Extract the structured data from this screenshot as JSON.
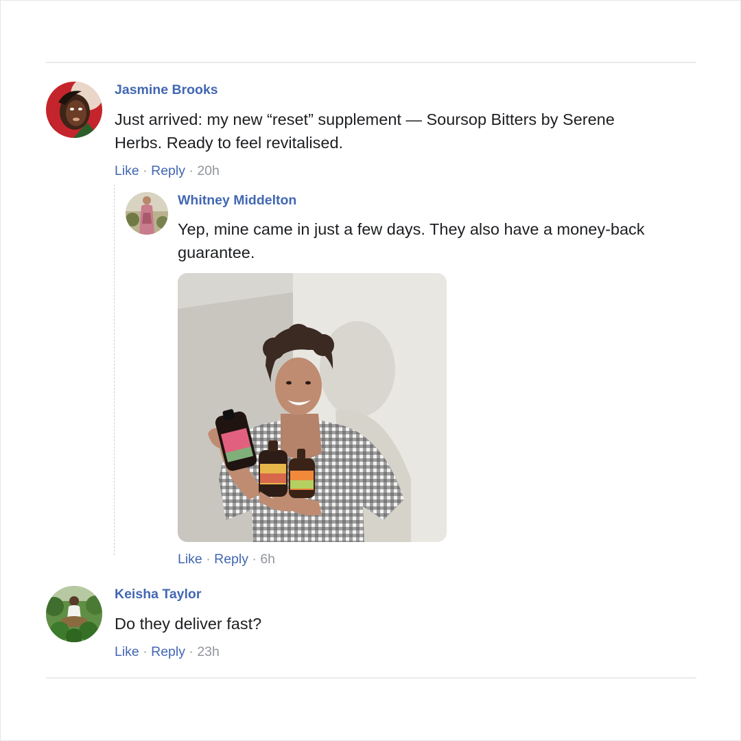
{
  "comments": [
    {
      "author": "Jasmine Brooks",
      "text_line1": "Just arrived: my new “reset” supplement — Soursop Bitters by Serene",
      "text_line2": "Herbs. Ready to feel revitalised.",
      "like_label": "Like",
      "reply_label": "Reply",
      "separator": "·",
      "time": "20h"
    },
    {
      "author": "Whitney Middelton",
      "text_line1": "Yep, mine came in just a few days. They also have a money-back",
      "text_line2": "guarantee.",
      "like_label": "Like",
      "reply_label": "Reply",
      "separator": "·",
      "time": "6h"
    },
    {
      "author": "Keisha Taylor",
      "text_line1": "Do they deliver fast?",
      "like_label": "Like",
      "reply_label": "Reply",
      "separator": "·",
      "time": "23h"
    }
  ],
  "colors": {
    "link": "#4267b2",
    "text": "#1c1e21",
    "muted": "#90949c",
    "divider": "#e9ebee"
  },
  "icons": {
    "photo_bottle_brand": "Serene"
  }
}
